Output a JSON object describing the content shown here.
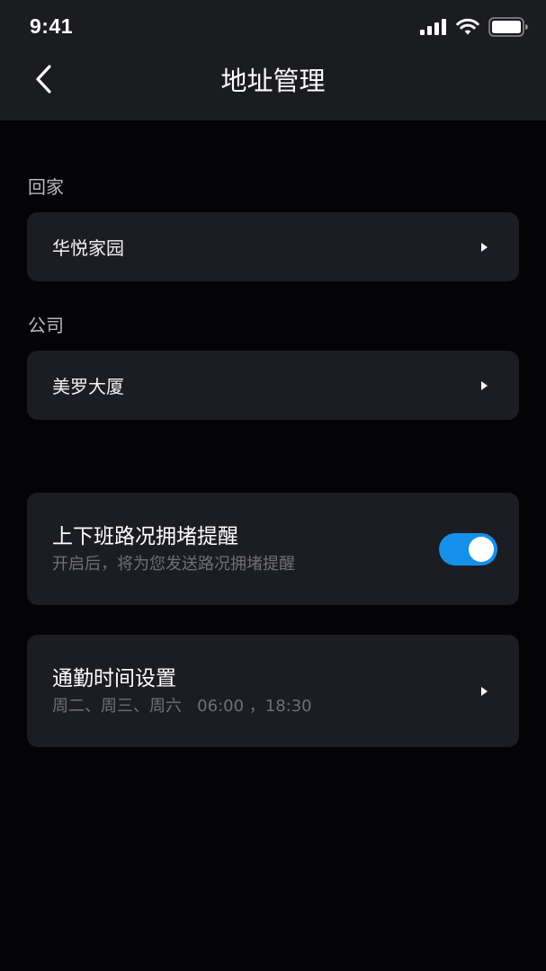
{
  "status_bar": {
    "time": "9:41",
    "icons": [
      "signal-icon",
      "wifi-icon",
      "battery-icon"
    ]
  },
  "nav": {
    "back_icon": "chevron-left-icon",
    "title": "地址管理"
  },
  "home": {
    "label": "回家",
    "address": "华悦家园"
  },
  "company": {
    "label": "公司",
    "address": "美罗大厦"
  },
  "congestion_reminder": {
    "title": "上下班路况拥堵提醒",
    "subtitle": "开启后，将为您发送路况拥堵提醒",
    "enabled": true
  },
  "commute_time": {
    "title": "通勤时间设置",
    "subtitle": "周二、周三、周六   06:00 ，18:30"
  },
  "colors": {
    "background": "#040406",
    "header": "#1b1c20",
    "card": "#1c1d22",
    "accent": "#1590ea",
    "subtext": "#6f7076"
  }
}
